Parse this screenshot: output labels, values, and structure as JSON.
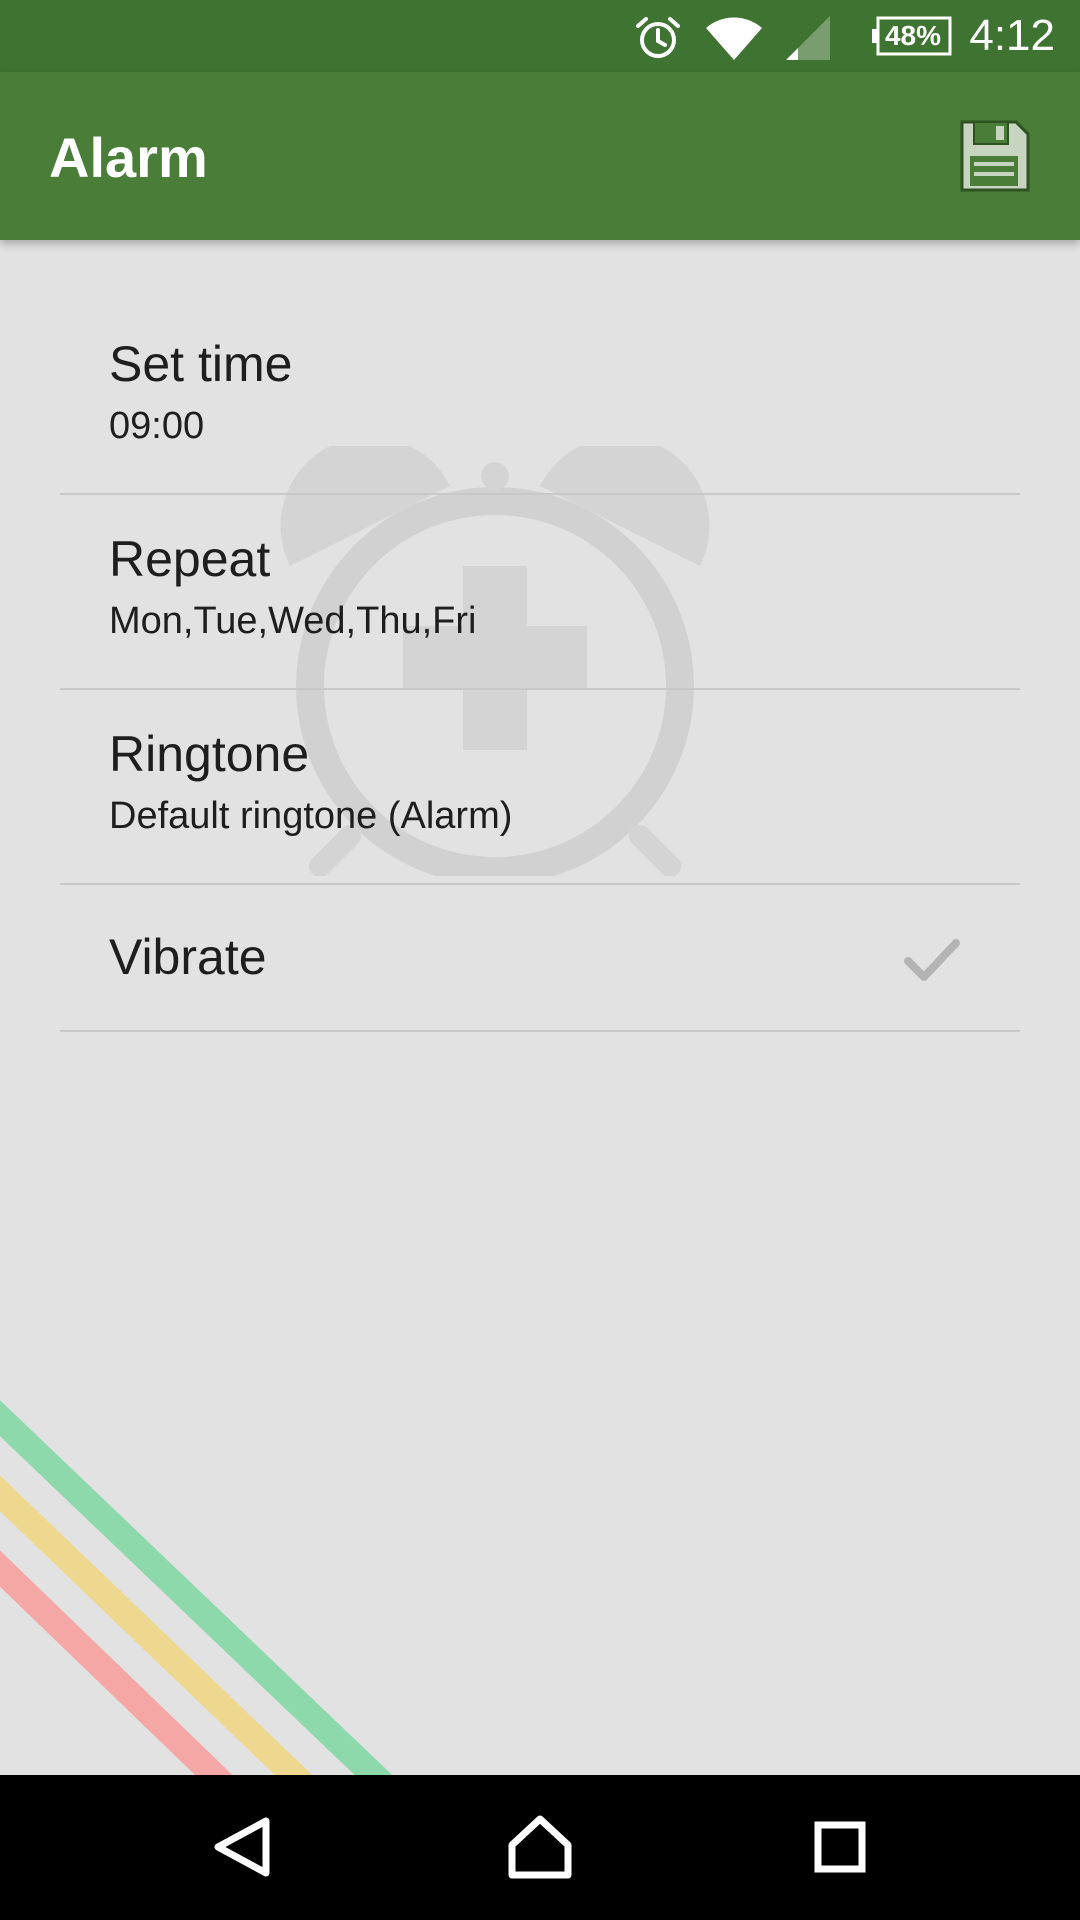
{
  "status_bar": {
    "time": "4:12",
    "battery_percent": "48%",
    "icons": [
      "alarm-icon",
      "wifi-icon",
      "cell-signal-icon",
      "battery-icon"
    ]
  },
  "app_bar": {
    "title": "Alarm",
    "action_icon": "save-icon"
  },
  "preferences": [
    {
      "title": "Set time",
      "summary": "09:00"
    },
    {
      "title": "Repeat",
      "summary": "Mon,Tue,Wed,Thu,Fri"
    },
    {
      "title": "Ringtone",
      "summary": "Default ringtone (Alarm)"
    },
    {
      "title": "Vibrate",
      "checked": true,
      "icon": "checkmark-icon"
    }
  ],
  "nav_bar": {
    "buttons": [
      "back-icon",
      "home-icon",
      "recents-icon"
    ]
  },
  "colors": {
    "status_bar": "#3f7331",
    "app_bar": "#4a7d38",
    "background": "#e2e2e2",
    "stripe_green": "#8ed9ab",
    "stripe_yellow": "#eed88f",
    "stripe_red": "#f4a7a4"
  }
}
